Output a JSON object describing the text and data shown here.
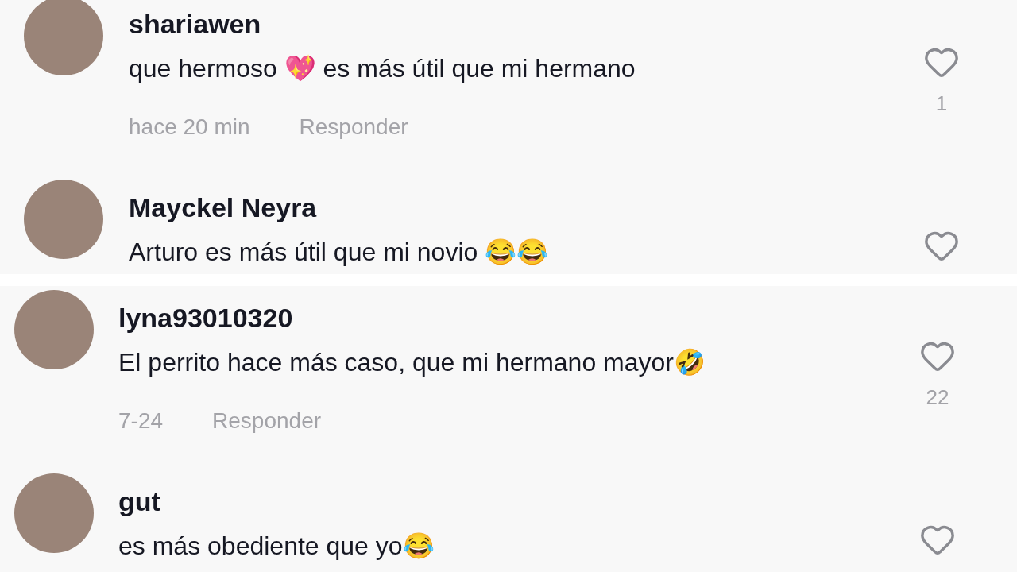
{
  "panels": [
    {
      "comments": [
        {
          "username": "shariawen",
          "text": "que hermoso 💖 es más útil que mi hermano",
          "time": "hace 20 min",
          "reply": "Responder",
          "likes": "1"
        },
        {
          "username": "Mayckel Neyra",
          "text": "Arturo es más útil que mi novio 😂😂"
        }
      ]
    },
    {
      "comments": [
        {
          "username": "lyna93010320",
          "text": "El perrito hace más caso, que mi hermano mayor🤣",
          "time": "7-24",
          "reply": "Responder",
          "likes": "22"
        },
        {
          "username": "gut",
          "text": "es más obediente que yo😂"
        }
      ]
    }
  ]
}
